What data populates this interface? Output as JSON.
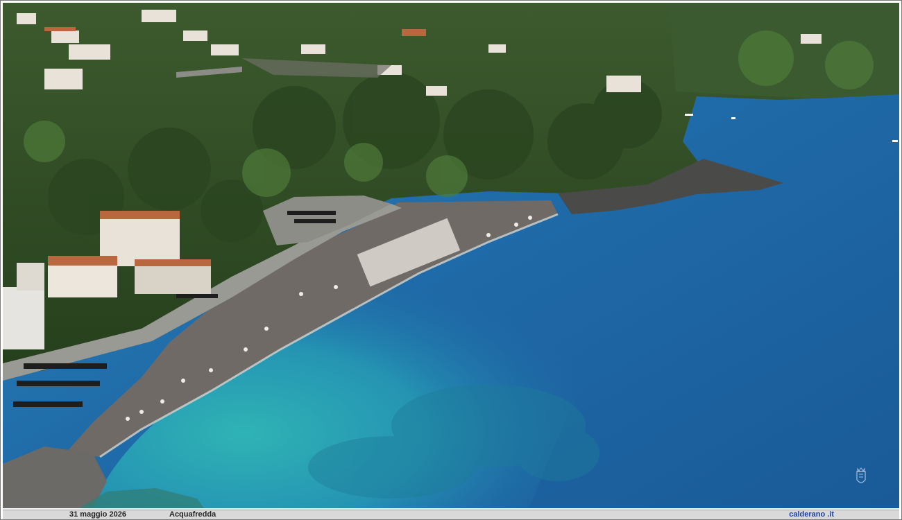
{
  "photo": {
    "subject": "Aerial view of a pebble beach bay with turquoise sea, wooded hillside and town",
    "colors": {
      "deep_sea": "#1f5f9e",
      "shallow_sea": "#2ba3b8",
      "beach": "#6f6a66",
      "forest": "#2f4a24",
      "rock": "#4a4a48",
      "building": "#e8e2d8",
      "roof": "#b8673e"
    }
  },
  "watermark": {
    "icon": "crest-icon"
  },
  "caption": {
    "date": "31  maggio 2026",
    "place": "Acquafredda",
    "site": "calderano .it"
  }
}
